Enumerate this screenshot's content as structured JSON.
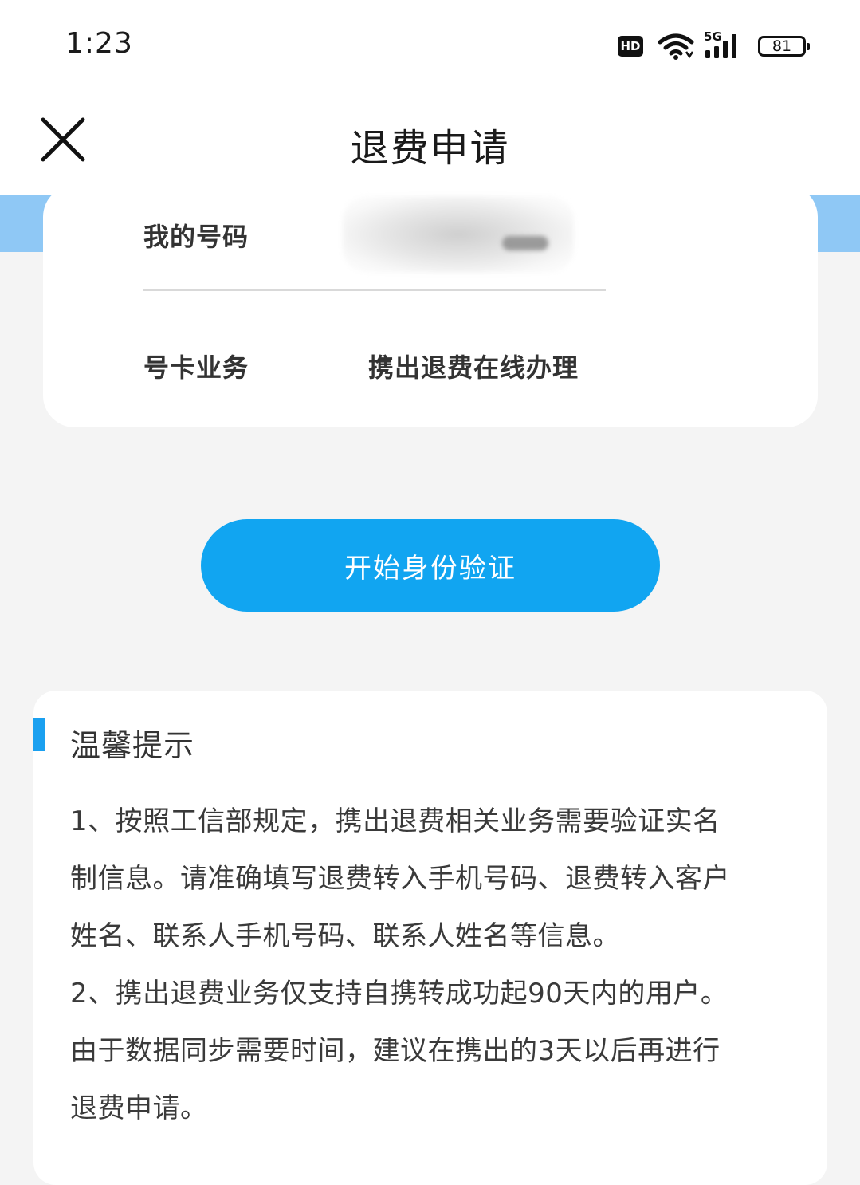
{
  "status_bar": {
    "time": "1:23",
    "hd_label": "HD",
    "network_label": "5G",
    "battery_level": "81"
  },
  "nav": {
    "title": "退费申请"
  },
  "info_card": {
    "number_label": "我的号码",
    "service_label": "号卡业务",
    "service_value": "携出退费在线办理"
  },
  "verify_button": {
    "label": "开始身份验证"
  },
  "tips": {
    "title": "温馨提示",
    "lines": [
      "1、按照工信部规定，携出退费相关业务需要验证实名",
      "制信息。请准确填写退费转入手机号码、退费转入客户",
      "姓名、联系人手机号码、联系人姓名等信息。",
      "2、携出退费业务仅支持自携转成功起90天内的用户。",
      "由于数据同步需要时间，建议在携出的3天以后再进行",
      "退费申请。"
    ]
  },
  "colors": {
    "accent": "#11a5f1",
    "banner": "#8fc8f5",
    "background": "#f4f4f4"
  }
}
